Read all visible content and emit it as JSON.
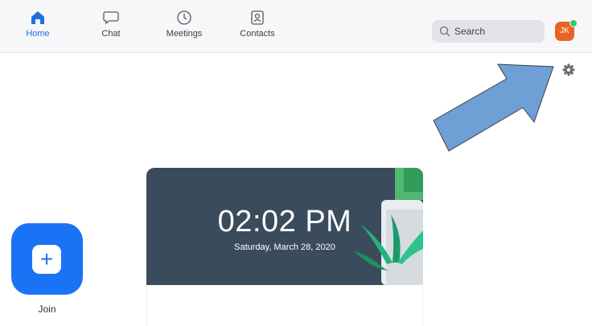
{
  "nav": {
    "items": [
      {
        "label": "Home",
        "icon": "home-icon",
        "active": true
      },
      {
        "label": "Chat",
        "icon": "chat-icon",
        "active": false
      },
      {
        "label": "Meetings",
        "icon": "clock-icon",
        "active": false
      },
      {
        "label": "Contacts",
        "icon": "contacts-icon",
        "active": false
      }
    ]
  },
  "search": {
    "label": "Search"
  },
  "avatar": {
    "initials": "JK",
    "color": "#e86424",
    "status_color": "#2dcd6f"
  },
  "join": {
    "label": "Join"
  },
  "clock": {
    "time": "02:02 PM",
    "date": "Saturday, March 28, 2020"
  },
  "colors": {
    "accent": "#1a73f5",
    "arrow": "#6e9fd5"
  }
}
